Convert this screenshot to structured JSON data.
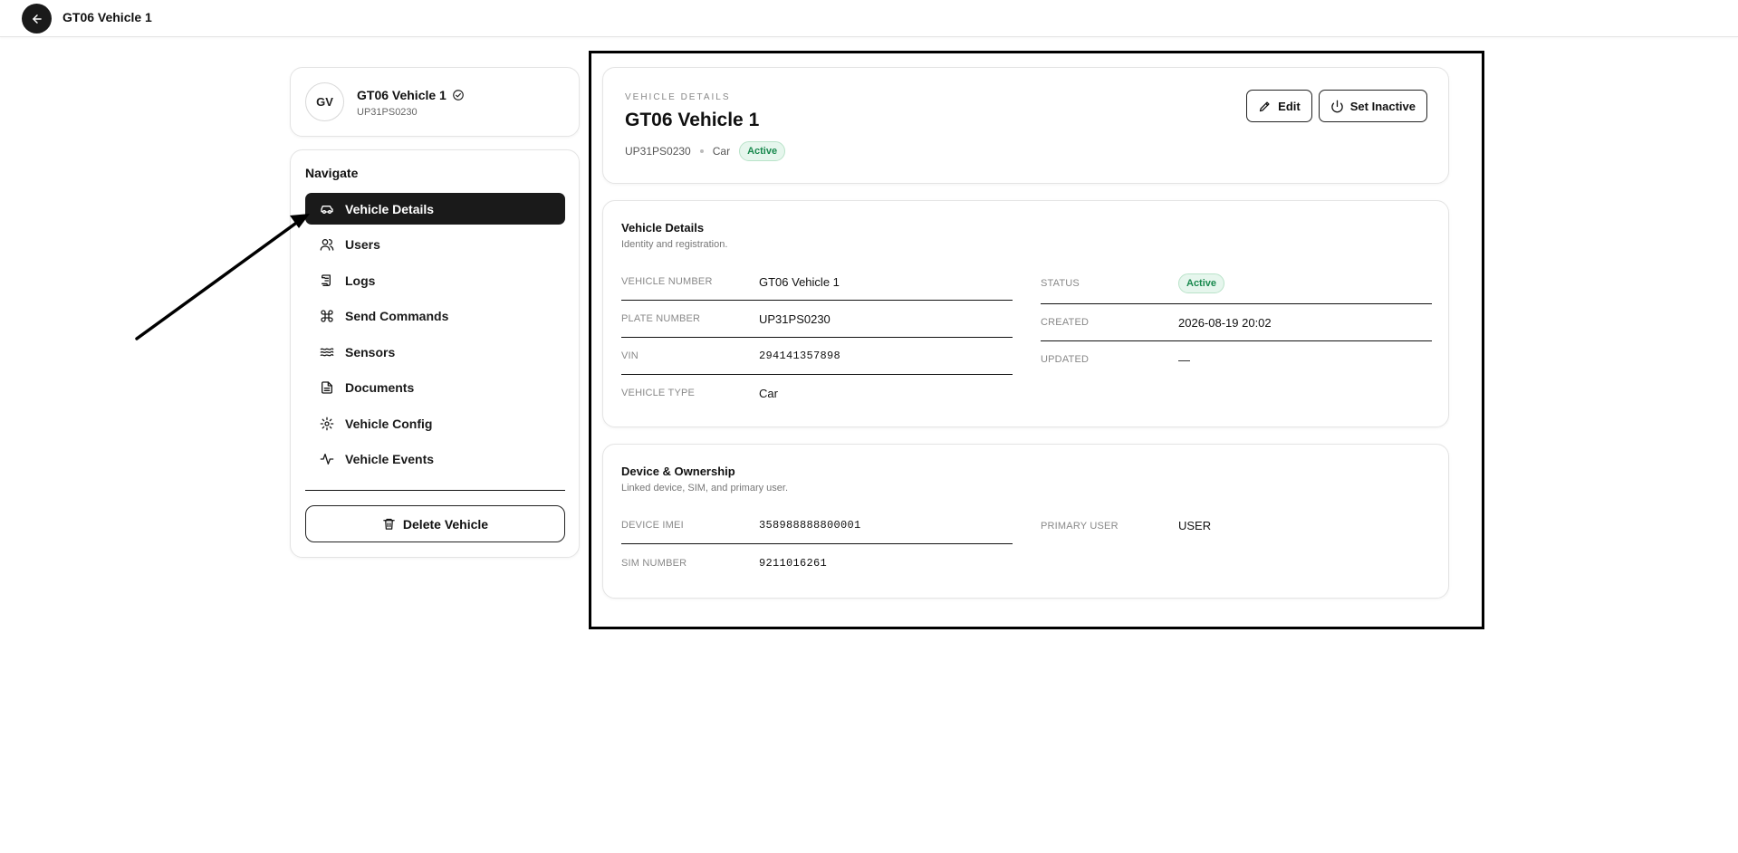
{
  "topbar": {
    "title": "GT06 Vehicle 1"
  },
  "profile": {
    "initials": "GV",
    "name": "GT06 Vehicle 1",
    "plate": "UP31PS0230"
  },
  "nav": {
    "heading": "Navigate",
    "items": [
      {
        "label": "Vehicle Details",
        "icon": "car-icon",
        "active": true
      },
      {
        "label": "Users",
        "icon": "users-icon"
      },
      {
        "label": "Logs",
        "icon": "scroll-icon"
      },
      {
        "label": "Send Commands",
        "icon": "command-icon"
      },
      {
        "label": "Sensors",
        "icon": "waves-icon"
      },
      {
        "label": "Documents",
        "icon": "document-icon"
      },
      {
        "label": "Vehicle Config",
        "icon": "gear-icon"
      },
      {
        "label": "Vehicle Events",
        "icon": "activity-icon"
      }
    ],
    "delete_label": "Delete Vehicle"
  },
  "header": {
    "eyebrow": "VEHICLE DETAILS",
    "title": "GT06 Vehicle 1",
    "plate": "UP31PS0230",
    "type": "Car",
    "status": "Active",
    "edit_label": "Edit",
    "inactive_label": "Set Inactive"
  },
  "details": {
    "title": "Vehicle Details",
    "subtitle": "Identity and registration.",
    "left": [
      {
        "label": "VEHICLE NUMBER",
        "value": "GT06 Vehicle 1"
      },
      {
        "label": "PLATE NUMBER",
        "value": "UP31PS0230"
      },
      {
        "label": "VIN",
        "value": "294141357898"
      },
      {
        "label": "VEHICLE TYPE",
        "value": "Car"
      }
    ],
    "right": [
      {
        "label": "STATUS",
        "value": "Active"
      },
      {
        "label": "CREATED",
        "value": "2026-08-19 20:02"
      },
      {
        "label": "UPDATED",
        "value": "—"
      }
    ]
  },
  "device": {
    "title": "Device & Ownership",
    "subtitle": "Linked device, SIM, and primary user.",
    "left": [
      {
        "label": "DEVICE IMEI",
        "value": "358988888800001"
      },
      {
        "label": "SIM NUMBER",
        "value": "9211016261"
      }
    ],
    "right": [
      {
        "label": "PRIMARY USER",
        "value": "USER"
      }
    ]
  },
  "colors": {
    "accent": "#1a1a1a",
    "status_bg": "#e6f6ed",
    "status_text": "#19894e"
  }
}
